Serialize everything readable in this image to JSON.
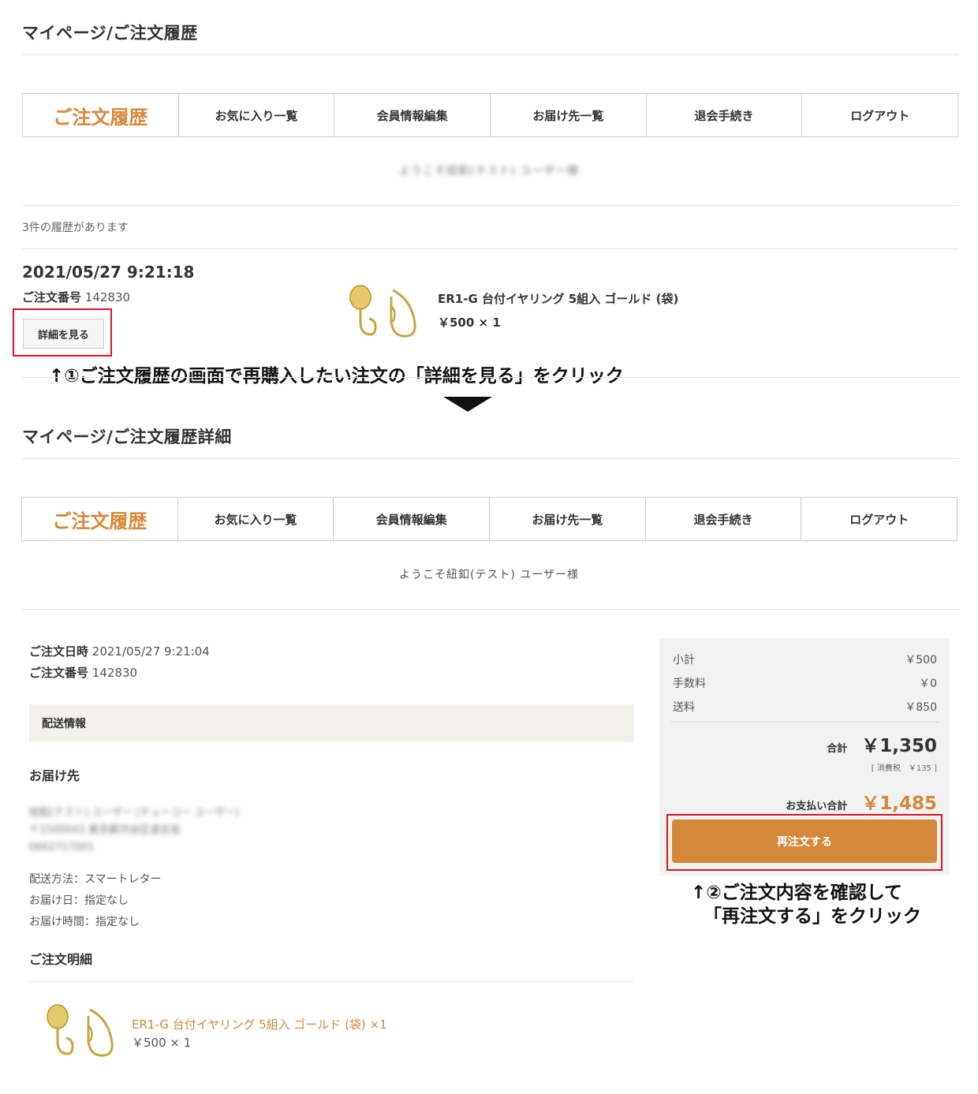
{
  "list_page": {
    "title": "マイページ/ご注文履歴",
    "tabs": [
      "ご注文履歴",
      "お気に入り一覧",
      "会員情報編集",
      "お届け先一覧",
      "退会手続き",
      "ログアウト"
    ],
    "welcome": "ようこそ紐釦(テスト) ユーザー様",
    "history_count": "3件の履歴があります",
    "order": {
      "datetime": "2021/05/27 9:21:18",
      "order_no_label": "ご注文番号",
      "order_no": "142830",
      "detail_button": "詳細を見る",
      "product_name": "ER1-G 台付イヤリング 5組入 ゴールド (袋)",
      "price_qty": "￥500 × 1"
    }
  },
  "annotation1": "↑①ご注文履歴の画面で再購入したい注文の「詳細を見る」をクリック",
  "detail_page": {
    "title": "マイページ/ご注文履歴詳細",
    "tabs": [
      "ご注文履歴",
      "お気に入り一覧",
      "会員情報編集",
      "お届け先一覧",
      "退会手続き",
      "ログアウト"
    ],
    "welcome": "ようこそ紐釦(テスト) ユーザー様",
    "order_date_label": "ご注文日時",
    "order_date": "2021/05/27 9:21:04",
    "order_no_label": "ご注文番号",
    "order_no": "142830",
    "shipping_section": "配送情報",
    "deliver_to_label": "お届け先",
    "address_lines": [
      "紐釦(テスト) ユーザー (チューコー ユーザー)",
      "〒1500043 東京都渋谷区道玄坂",
      "0662717001"
    ],
    "shipping_method": "配送方法：スマートレター",
    "delivery_date": "お届け日：指定なし",
    "delivery_time": "お届け時間：指定なし",
    "items_label": "ご注文明細",
    "item_name": "ER1-G 台付イヤリング 5組入 ゴールド (袋) ×1",
    "item_price": "￥500 × 1",
    "summary": {
      "subtotal_label": "小計",
      "subtotal": "￥500",
      "fee_label": "手数料",
      "fee": "￥0",
      "shipping_label": "送料",
      "shipping": "￥850",
      "total_label": "合計",
      "total": "￥1,350",
      "tax_note": "[ 消費税　￥135 ]",
      "pay_label": "お支払い合計",
      "pay": "￥1,485",
      "reorder_button": "再注文する"
    }
  },
  "annotation2_line1": "↑②ご注文内容を確認して",
  "annotation2_line2": "「再注文する」をクリック",
  "colors": {
    "accent": "#d3883a",
    "highlight": "#e0141e"
  }
}
